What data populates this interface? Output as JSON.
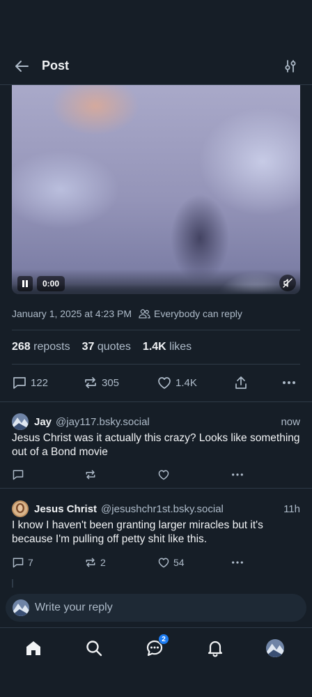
{
  "header": {
    "title": "Post"
  },
  "video": {
    "time": "0:00"
  },
  "post": {
    "date": "January 1, 2025 at 4:23 PM",
    "reply_setting": "Everybody can reply",
    "stats": {
      "reposts_count": "268",
      "reposts_label": "reposts",
      "quotes_count": "37",
      "quotes_label": "quotes",
      "likes_count": "1.4K",
      "likes_label": "likes"
    },
    "actions": {
      "replies": "122",
      "reposts": "305",
      "likes": "1.4K"
    }
  },
  "replies": [
    {
      "name": "Jay",
      "handle": "@jay117.bsky.social",
      "time": "now",
      "text": "Jesus Christ was it actually this crazy? Looks like something out of a Bond movie",
      "replies": "",
      "reposts": "",
      "likes": ""
    },
    {
      "name": "Jesus Christ",
      "handle": "@jesushchr1st.bsky.social",
      "time": "11h",
      "text": "I know I haven't been granting larger miracles but it's because I'm pulling off petty shit like this.",
      "replies": "7",
      "reposts": "2",
      "likes": "54"
    }
  ],
  "compose": {
    "placeholder": "Write your reply"
  },
  "tabbar": {
    "chat_badge": "2"
  },
  "colors": {
    "background": "#161e27",
    "accent": "#1d7cf2",
    "muted": "#aebbc9",
    "border": "#2e3a47"
  },
  "icons": [
    "back-arrow-icon",
    "sliders-icon",
    "pause-icon",
    "mute-icon",
    "people-icon",
    "comment-icon",
    "repost-icon",
    "heart-icon",
    "share-icon",
    "more-icon",
    "home-icon",
    "search-icon",
    "chat-icon",
    "bell-icon"
  ]
}
